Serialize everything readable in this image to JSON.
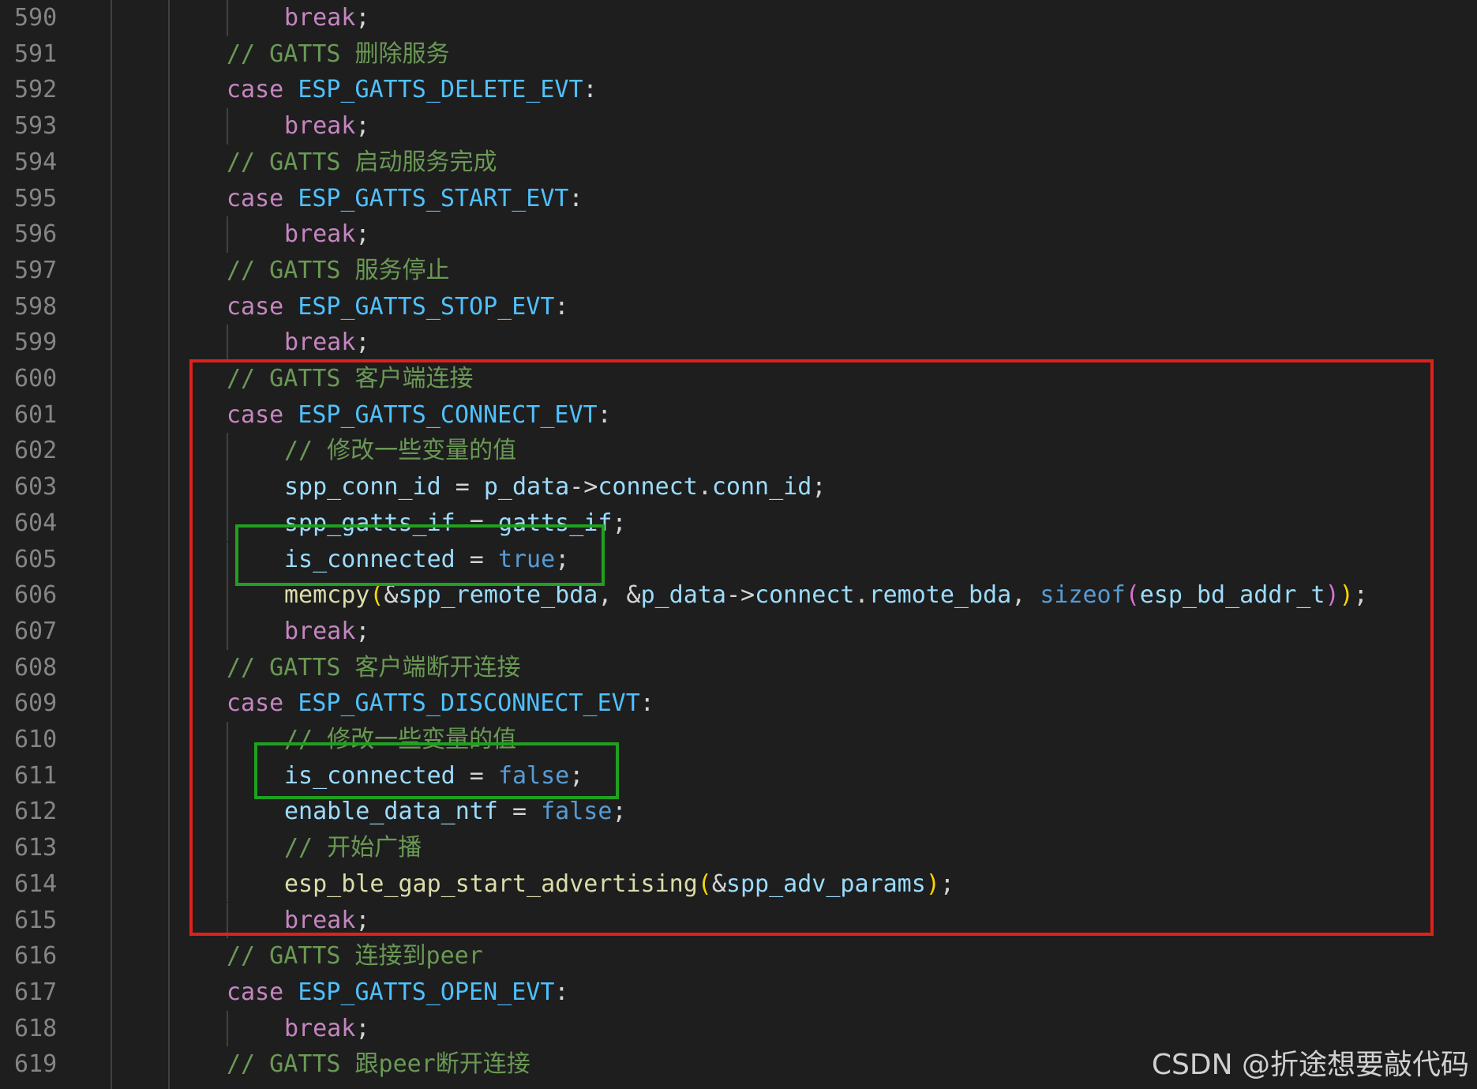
{
  "editor": {
    "lines": [
      {
        "n": "590",
        "segs": [
          {
            "t": "break",
            "c": "kw"
          },
          {
            "t": ";",
            "c": ""
          }
        ],
        "indent": 2
      },
      {
        "n": "591",
        "segs": [
          {
            "t": "// GATTS 删除服务",
            "c": "cm"
          }
        ],
        "indent": 1
      },
      {
        "n": "592",
        "segs": [
          {
            "t": "case ",
            "c": "kw"
          },
          {
            "t": "ESP_GATTS_DELETE_EVT",
            "c": "en"
          },
          {
            "t": ":",
            "c": ""
          }
        ],
        "indent": 1
      },
      {
        "n": "593",
        "segs": [
          {
            "t": "break",
            "c": "kw"
          },
          {
            "t": ";",
            "c": ""
          }
        ],
        "indent": 2
      },
      {
        "n": "594",
        "segs": [
          {
            "t": "// GATTS 启动服务完成",
            "c": "cm"
          }
        ],
        "indent": 1
      },
      {
        "n": "595",
        "segs": [
          {
            "t": "case ",
            "c": "kw"
          },
          {
            "t": "ESP_GATTS_START_EVT",
            "c": "en"
          },
          {
            "t": ":",
            "c": ""
          }
        ],
        "indent": 1
      },
      {
        "n": "596",
        "segs": [
          {
            "t": "break",
            "c": "kw"
          },
          {
            "t": ";",
            "c": ""
          }
        ],
        "indent": 2
      },
      {
        "n": "597",
        "segs": [
          {
            "t": "// GATTS 服务停止",
            "c": "cm"
          }
        ],
        "indent": 1
      },
      {
        "n": "598",
        "segs": [
          {
            "t": "case ",
            "c": "kw"
          },
          {
            "t": "ESP_GATTS_STOP_EVT",
            "c": "en"
          },
          {
            "t": ":",
            "c": ""
          }
        ],
        "indent": 1
      },
      {
        "n": "599",
        "segs": [
          {
            "t": "break",
            "c": "kw"
          },
          {
            "t": ";",
            "c": ""
          }
        ],
        "indent": 2
      },
      {
        "n": "600",
        "segs": [
          {
            "t": "// GATTS 客户端连接",
            "c": "cm"
          }
        ],
        "indent": 1
      },
      {
        "n": "601",
        "segs": [
          {
            "t": "case ",
            "c": "kw"
          },
          {
            "t": "ESP_GATTS_CONNECT_EVT",
            "c": "en"
          },
          {
            "t": ":",
            "c": ""
          }
        ],
        "indent": 1
      },
      {
        "n": "602",
        "segs": [
          {
            "t": "// 修改一些变量的值",
            "c": "cm"
          }
        ],
        "indent": 2
      },
      {
        "n": "603",
        "segs": [
          {
            "t": "spp_conn_id",
            "c": "var"
          },
          {
            "t": " = ",
            "c": ""
          },
          {
            "t": "p_data",
            "c": "var"
          },
          {
            "t": "->",
            "c": ""
          },
          {
            "t": "connect",
            "c": "var"
          },
          {
            "t": ".",
            "c": ""
          },
          {
            "t": "conn_id",
            "c": "var"
          },
          {
            "t": ";",
            "c": ""
          }
        ],
        "indent": 2
      },
      {
        "n": "604",
        "segs": [
          {
            "t": "spp_gatts_if",
            "c": "var"
          },
          {
            "t": " = ",
            "c": ""
          },
          {
            "t": "gatts_if",
            "c": "var"
          },
          {
            "t": ";",
            "c": ""
          }
        ],
        "indent": 2
      },
      {
        "n": "605",
        "segs": [
          {
            "t": "is_connected",
            "c": "var"
          },
          {
            "t": " = ",
            "c": ""
          },
          {
            "t": "true",
            "c": "bool"
          },
          {
            "t": ";",
            "c": ""
          }
        ],
        "indent": 2
      },
      {
        "n": "606",
        "segs": [
          {
            "t": "memcpy",
            "c": "fn"
          },
          {
            "t": "(",
            "c": "br1"
          },
          {
            "t": "&",
            "c": ""
          },
          {
            "t": "spp_remote_bda",
            "c": "var"
          },
          {
            "t": ", &",
            "c": ""
          },
          {
            "t": "p_data",
            "c": "var"
          },
          {
            "t": "->",
            "c": ""
          },
          {
            "t": "connect",
            "c": "var"
          },
          {
            "t": ".",
            "c": ""
          },
          {
            "t": "remote_bda",
            "c": "var"
          },
          {
            "t": ", ",
            "c": ""
          },
          {
            "t": "sizeof",
            "c": "bool"
          },
          {
            "t": "(",
            "c": "br2"
          },
          {
            "t": "esp_bd_addr_t",
            "c": "var"
          },
          {
            "t": ")",
            "c": "br2"
          },
          {
            "t": ")",
            "c": "br1"
          },
          {
            "t": ";",
            "c": ""
          }
        ],
        "indent": 2
      },
      {
        "n": "607",
        "segs": [
          {
            "t": "break",
            "c": "kw"
          },
          {
            "t": ";",
            "c": ""
          }
        ],
        "indent": 2
      },
      {
        "n": "608",
        "segs": [
          {
            "t": "// GATTS 客户端断开连接",
            "c": "cm"
          }
        ],
        "indent": 1
      },
      {
        "n": "609",
        "segs": [
          {
            "t": "case ",
            "c": "kw"
          },
          {
            "t": "ESP_GATTS_DISCONNECT_EVT",
            "c": "en"
          },
          {
            "t": ":",
            "c": ""
          }
        ],
        "indent": 1
      },
      {
        "n": "610",
        "segs": [
          {
            "t": "// 修改一些变量的值",
            "c": "cm"
          }
        ],
        "indent": 2
      },
      {
        "n": "611",
        "segs": [
          {
            "t": "is_connected",
            "c": "var"
          },
          {
            "t": " = ",
            "c": ""
          },
          {
            "t": "false",
            "c": "bool"
          },
          {
            "t": ";",
            "c": ""
          }
        ],
        "indent": 2
      },
      {
        "n": "612",
        "segs": [
          {
            "t": "enable_data_ntf",
            "c": "var"
          },
          {
            "t": " = ",
            "c": ""
          },
          {
            "t": "false",
            "c": "bool"
          },
          {
            "t": ";",
            "c": ""
          }
        ],
        "indent": 2
      },
      {
        "n": "613",
        "segs": [
          {
            "t": "// 开始广播",
            "c": "cm"
          }
        ],
        "indent": 2
      },
      {
        "n": "614",
        "segs": [
          {
            "t": "esp_ble_gap_start_advertising",
            "c": "fn"
          },
          {
            "t": "(",
            "c": "br1"
          },
          {
            "t": "&",
            "c": ""
          },
          {
            "t": "spp_adv_params",
            "c": "var"
          },
          {
            "t": ")",
            "c": "br1"
          },
          {
            "t": ";",
            "c": ""
          }
        ],
        "indent": 2
      },
      {
        "n": "615",
        "segs": [
          {
            "t": "break",
            "c": "kw"
          },
          {
            "t": ";",
            "c": ""
          }
        ],
        "indent": 2
      },
      {
        "n": "616",
        "segs": [
          {
            "t": "// GATTS 连接到peer",
            "c": "cm"
          }
        ],
        "indent": 1
      },
      {
        "n": "617",
        "segs": [
          {
            "t": "case ",
            "c": "kw"
          },
          {
            "t": "ESP_GATTS_OPEN_EVT",
            "c": "en"
          },
          {
            "t": ":",
            "c": ""
          }
        ],
        "indent": 1
      },
      {
        "n": "618",
        "segs": [
          {
            "t": "break",
            "c": "kw"
          },
          {
            "t": ";",
            "c": ""
          }
        ],
        "indent": 2
      },
      {
        "n": "619",
        "segs": [
          {
            "t": "// GATTS 跟peer断开连接",
            "c": "cm"
          }
        ],
        "indent": 1
      }
    ]
  },
  "highlights": {
    "red_box_color": "#e0201b",
    "green_box_color": "#20a020"
  },
  "watermark": "CSDN @折途想要敲代码"
}
